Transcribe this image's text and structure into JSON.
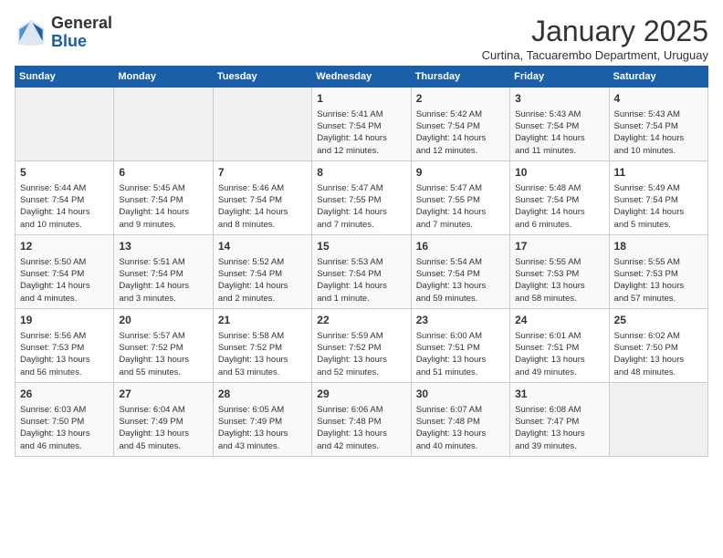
{
  "logo": {
    "general": "General",
    "blue": "Blue"
  },
  "header": {
    "month": "January 2025",
    "location": "Curtina, Tacuarembo Department, Uruguay"
  },
  "weekdays": [
    "Sunday",
    "Monday",
    "Tuesday",
    "Wednesday",
    "Thursday",
    "Friday",
    "Saturday"
  ],
  "weeks": [
    [
      {
        "day": "",
        "info": ""
      },
      {
        "day": "",
        "info": ""
      },
      {
        "day": "",
        "info": ""
      },
      {
        "day": "1",
        "info": "Sunrise: 5:41 AM\nSunset: 7:54 PM\nDaylight: 14 hours\nand 12 minutes."
      },
      {
        "day": "2",
        "info": "Sunrise: 5:42 AM\nSunset: 7:54 PM\nDaylight: 14 hours\nand 12 minutes."
      },
      {
        "day": "3",
        "info": "Sunrise: 5:43 AM\nSunset: 7:54 PM\nDaylight: 14 hours\nand 11 minutes."
      },
      {
        "day": "4",
        "info": "Sunrise: 5:43 AM\nSunset: 7:54 PM\nDaylight: 14 hours\nand 10 minutes."
      }
    ],
    [
      {
        "day": "5",
        "info": "Sunrise: 5:44 AM\nSunset: 7:54 PM\nDaylight: 14 hours\nand 10 minutes."
      },
      {
        "day": "6",
        "info": "Sunrise: 5:45 AM\nSunset: 7:54 PM\nDaylight: 14 hours\nand 9 minutes."
      },
      {
        "day": "7",
        "info": "Sunrise: 5:46 AM\nSunset: 7:54 PM\nDaylight: 14 hours\nand 8 minutes."
      },
      {
        "day": "8",
        "info": "Sunrise: 5:47 AM\nSunset: 7:55 PM\nDaylight: 14 hours\nand 7 minutes."
      },
      {
        "day": "9",
        "info": "Sunrise: 5:47 AM\nSunset: 7:55 PM\nDaylight: 14 hours\nand 7 minutes."
      },
      {
        "day": "10",
        "info": "Sunrise: 5:48 AM\nSunset: 7:54 PM\nDaylight: 14 hours\nand 6 minutes."
      },
      {
        "day": "11",
        "info": "Sunrise: 5:49 AM\nSunset: 7:54 PM\nDaylight: 14 hours\nand 5 minutes."
      }
    ],
    [
      {
        "day": "12",
        "info": "Sunrise: 5:50 AM\nSunset: 7:54 PM\nDaylight: 14 hours\nand 4 minutes."
      },
      {
        "day": "13",
        "info": "Sunrise: 5:51 AM\nSunset: 7:54 PM\nDaylight: 14 hours\nand 3 minutes."
      },
      {
        "day": "14",
        "info": "Sunrise: 5:52 AM\nSunset: 7:54 PM\nDaylight: 14 hours\nand 2 minutes."
      },
      {
        "day": "15",
        "info": "Sunrise: 5:53 AM\nSunset: 7:54 PM\nDaylight: 14 hours\nand 1 minute."
      },
      {
        "day": "16",
        "info": "Sunrise: 5:54 AM\nSunset: 7:54 PM\nDaylight: 13 hours\nand 59 minutes."
      },
      {
        "day": "17",
        "info": "Sunrise: 5:55 AM\nSunset: 7:53 PM\nDaylight: 13 hours\nand 58 minutes."
      },
      {
        "day": "18",
        "info": "Sunrise: 5:55 AM\nSunset: 7:53 PM\nDaylight: 13 hours\nand 57 minutes."
      }
    ],
    [
      {
        "day": "19",
        "info": "Sunrise: 5:56 AM\nSunset: 7:53 PM\nDaylight: 13 hours\nand 56 minutes."
      },
      {
        "day": "20",
        "info": "Sunrise: 5:57 AM\nSunset: 7:52 PM\nDaylight: 13 hours\nand 55 minutes."
      },
      {
        "day": "21",
        "info": "Sunrise: 5:58 AM\nSunset: 7:52 PM\nDaylight: 13 hours\nand 53 minutes."
      },
      {
        "day": "22",
        "info": "Sunrise: 5:59 AM\nSunset: 7:52 PM\nDaylight: 13 hours\nand 52 minutes."
      },
      {
        "day": "23",
        "info": "Sunrise: 6:00 AM\nSunset: 7:51 PM\nDaylight: 13 hours\nand 51 minutes."
      },
      {
        "day": "24",
        "info": "Sunrise: 6:01 AM\nSunset: 7:51 PM\nDaylight: 13 hours\nand 49 minutes."
      },
      {
        "day": "25",
        "info": "Sunrise: 6:02 AM\nSunset: 7:50 PM\nDaylight: 13 hours\nand 48 minutes."
      }
    ],
    [
      {
        "day": "26",
        "info": "Sunrise: 6:03 AM\nSunset: 7:50 PM\nDaylight: 13 hours\nand 46 minutes."
      },
      {
        "day": "27",
        "info": "Sunrise: 6:04 AM\nSunset: 7:49 PM\nDaylight: 13 hours\nand 45 minutes."
      },
      {
        "day": "28",
        "info": "Sunrise: 6:05 AM\nSunset: 7:49 PM\nDaylight: 13 hours\nand 43 minutes."
      },
      {
        "day": "29",
        "info": "Sunrise: 6:06 AM\nSunset: 7:48 PM\nDaylight: 13 hours\nand 42 minutes."
      },
      {
        "day": "30",
        "info": "Sunrise: 6:07 AM\nSunset: 7:48 PM\nDaylight: 13 hours\nand 40 minutes."
      },
      {
        "day": "31",
        "info": "Sunrise: 6:08 AM\nSunset: 7:47 PM\nDaylight: 13 hours\nand 39 minutes."
      },
      {
        "day": "",
        "info": ""
      }
    ]
  ]
}
